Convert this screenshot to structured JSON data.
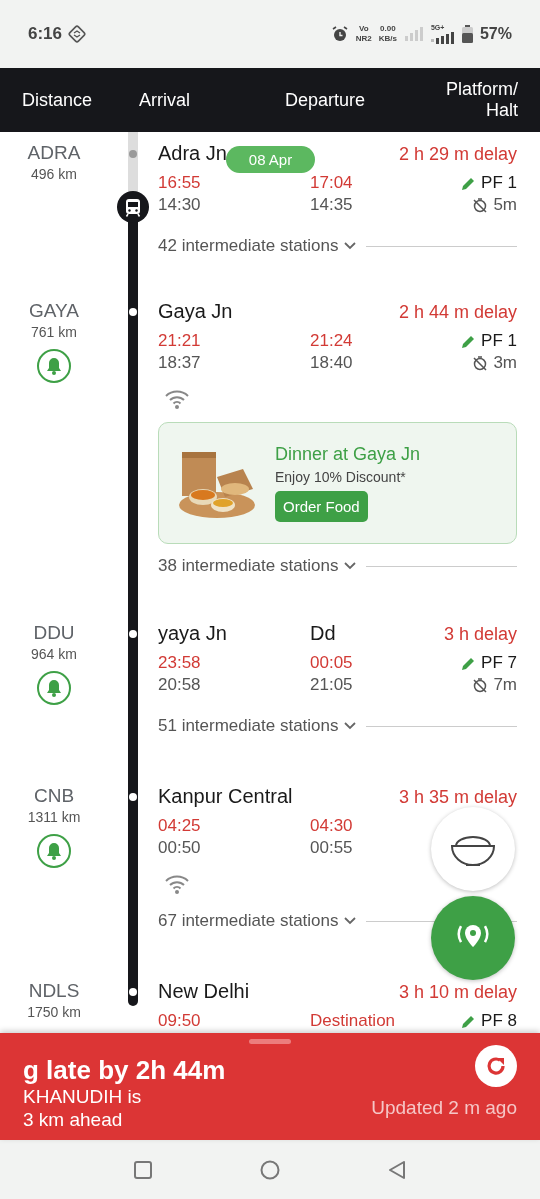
{
  "status_bar": {
    "time": "6:16",
    "volte_top": "Vo",
    "volte_bottom": "NR2",
    "speed_value": "0.00",
    "speed_unit": "KB/s",
    "network": "5G+",
    "battery": "57%"
  },
  "header": {
    "columns": [
      "Distance",
      "Arrival",
      "Departure",
      "Platform/ Halt"
    ]
  },
  "date_pill": "08 Apr",
  "stations": [
    {
      "code": "ADRA",
      "km": "496 km",
      "alarm": false,
      "passed": true,
      "train_here": true,
      "name": "Adra Jn",
      "delay": "2 h 29 m delay",
      "arr_actual": "16:55",
      "arr_sched": "14:30",
      "dep_actual": "17:04",
      "dep_sched": "14:35",
      "platform": "PF 1",
      "halt": "5m",
      "wifi": false,
      "intermediate": "42 intermediate stations"
    },
    {
      "code": "GAYA",
      "km": "761 km",
      "alarm": true,
      "passed": false,
      "train_here": false,
      "name": "Gaya Jn",
      "delay": "2 h 44 m delay",
      "arr_actual": "21:21",
      "arr_sched": "18:37",
      "dep_actual": "21:24",
      "dep_sched": "18:40",
      "platform": "PF 1",
      "halt": "3m",
      "wifi": true,
      "promo": {
        "title": "Dinner at Gaya Jn",
        "subtitle": "Enjoy 10% Discount*",
        "button": "Order Food"
      },
      "intermediate": "38 intermediate stations"
    },
    {
      "code": "DDU",
      "km": "964 km",
      "alarm": true,
      "passed": false,
      "train_here": false,
      "name": "yaya Jn",
      "name_trail": "Dd",
      "delay": "3 h delay",
      "arr_actual": "23:58",
      "arr_sched": "20:58",
      "dep_actual": "00:05",
      "dep_sched": "21:05",
      "platform": "PF 7",
      "halt": "7m",
      "wifi": false,
      "intermediate": "51 intermediate stations"
    },
    {
      "code": "CNB",
      "km": "1311 km",
      "alarm": true,
      "passed": false,
      "train_here": false,
      "name": "Kanpur Central",
      "delay": "3 h 35 m delay",
      "arr_actual": "04:25",
      "arr_sched": "00:50",
      "dep_actual": "04:30",
      "dep_sched": "00:55",
      "wifi": true,
      "intermediate": "67 intermediate stations"
    },
    {
      "code": "NDLS",
      "km": "1750 km",
      "alarm": false,
      "passed": false,
      "train_here": false,
      "name": "New Delhi",
      "delay": "3 h 10 m delay",
      "arr_actual": "09:50",
      "dep_actual": "Destination",
      "platform": "PF 8",
      "wifi": false
    }
  ],
  "sheet": {
    "headline": "g late by 2h 44m",
    "location_line1": "KHANUDIH is",
    "location_line2": "3 km ahead",
    "updated": "Updated 2 m  ago"
  }
}
